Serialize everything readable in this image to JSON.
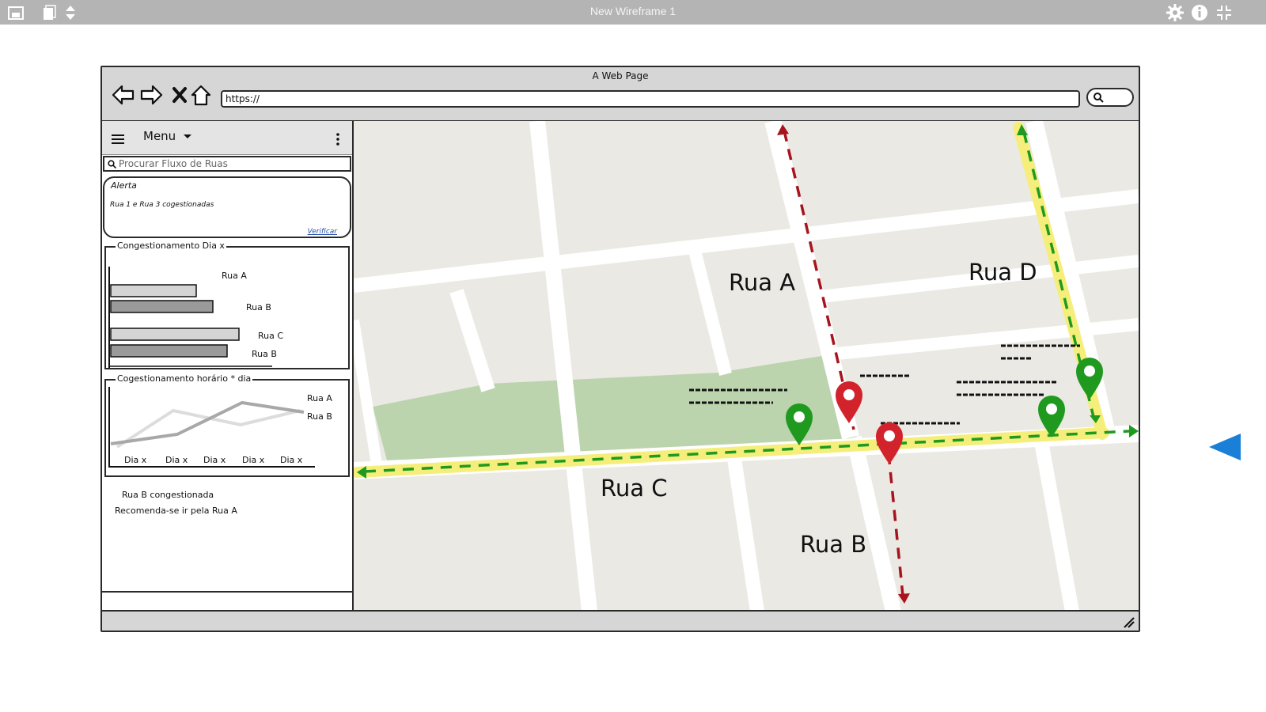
{
  "app": {
    "title": "New Wireframe 1"
  },
  "browser": {
    "page_title": "A Web Page",
    "url": "https://"
  },
  "sidebar": {
    "menu_label": "Menu",
    "search_placeholder": "Procurar Fluxo de Ruas",
    "alert": {
      "title": "Alerta",
      "message": "Rua 1 e Rua 3 cogestionadas",
      "link": "Verificar"
    },
    "bar_panel": {
      "title": "Congestionamento Dia x",
      "labels": [
        "Rua A",
        "Rua B",
        "Rua C",
        "Rua B"
      ]
    },
    "line_panel": {
      "title": "Cogestionamento horário * dia",
      "series": [
        "Rua A",
        "Rua B"
      ],
      "x_labels": [
        "Dia x",
        "Dia x",
        "Dia x",
        "Dia x",
        "Dia x"
      ]
    },
    "notes": [
      "Rua B congestionada",
      "Recomenda-se ir pela Rua A"
    ]
  },
  "map": {
    "streets": [
      "Rua A",
      "Rua D",
      "Rua C",
      "Rua B"
    ],
    "colors": {
      "congested": "#c8202a",
      "free": "#1f9a1f",
      "highlight": "#f5ee7a",
      "park": "#bcd4ae"
    }
  }
}
